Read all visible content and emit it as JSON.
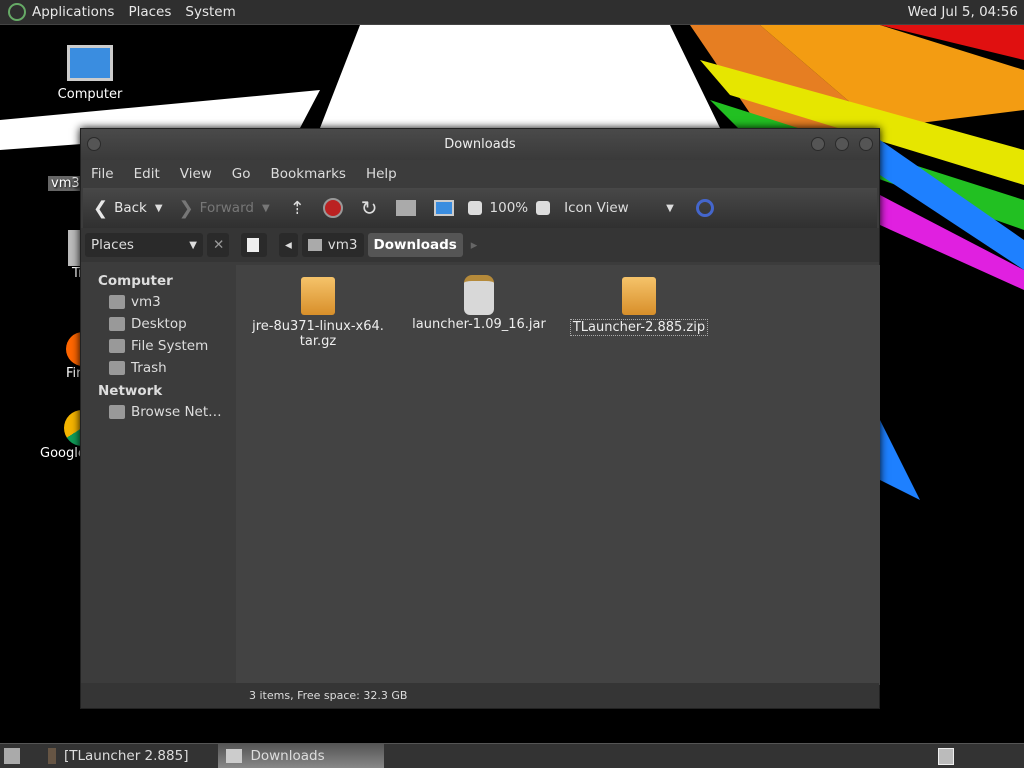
{
  "top_panel": {
    "menus": [
      "Applications",
      "Places",
      "System"
    ],
    "clock": "Wed Jul  5, 04:56"
  },
  "desktop_icons": [
    {
      "label": "Computer"
    },
    {
      "label": "vm3"
    },
    {
      "label": "Trash"
    },
    {
      "label": "Firefox"
    },
    {
      "label": "Google Chrome"
    }
  ],
  "window": {
    "title": "Downloads",
    "menu": [
      "File",
      "Edit",
      "View",
      "Go",
      "Bookmarks",
      "Help"
    ],
    "toolbar": {
      "back": "Back",
      "forward": "Forward",
      "zoom": "100%",
      "view": "Icon View"
    },
    "location": {
      "sidebar_select": "Places",
      "crumbs": [
        "vm3",
        "Downloads"
      ]
    },
    "sidebar": {
      "sections": [
        {
          "heading": "Computer",
          "items": [
            "vm3",
            "Desktop",
            "File System",
            "Trash"
          ]
        },
        {
          "heading": "Network",
          "items": [
            "Browse Net…"
          ]
        }
      ]
    },
    "files": [
      {
        "name": "jre-8u371-linux-x64.\ntar.gz",
        "type": "archive"
      },
      {
        "name": "launcher-1.09_16.jar",
        "type": "jar"
      },
      {
        "name": "TLauncher-2.885.zip",
        "type": "archive",
        "selected": true
      }
    ],
    "status": "3 items, Free space: 32.3 GB"
  },
  "taskbar": {
    "tasks": [
      "[TLauncher 2.885]",
      "Downloads"
    ]
  }
}
